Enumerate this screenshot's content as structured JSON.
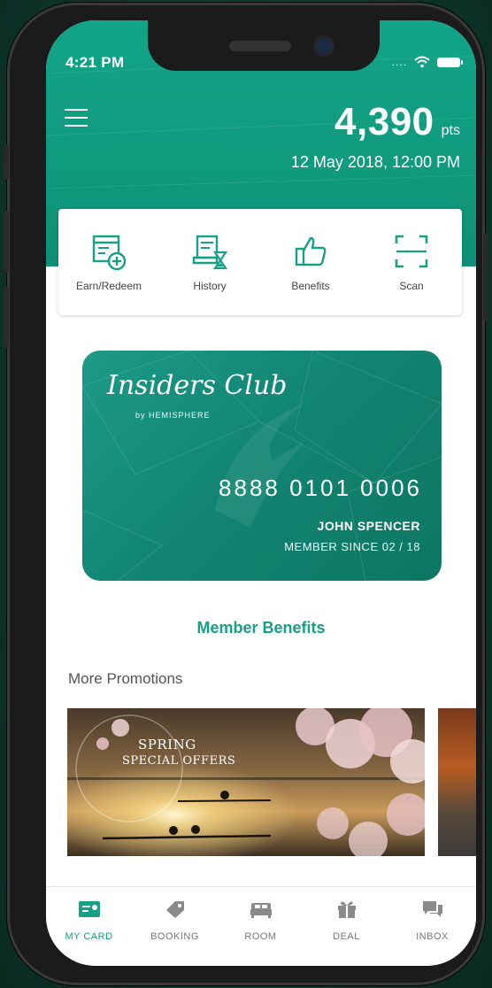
{
  "status_bar": {
    "time": "4:21 PM",
    "signal": "...."
  },
  "header": {
    "points_value": "4,390",
    "points_unit": "pts",
    "datetime": "12 May 2018, 12:00 PM"
  },
  "actions": [
    {
      "label": "Earn/Redeem",
      "icon": "calendar-add-icon"
    },
    {
      "label": "History",
      "icon": "history-icon"
    },
    {
      "label": "Benefits",
      "icon": "thumbs-up-icon"
    },
    {
      "label": "Scan",
      "icon": "scan-icon"
    }
  ],
  "card": {
    "logo": "Insiders Club",
    "logo_by": "by HEMISPHERE",
    "number": "8888 0101 0006",
    "holder": "JOHN SPENCER",
    "member_since": "MEMBER SINCE 02 / 18"
  },
  "member_benefits_link": "Member Benefits",
  "more_promotions_title": "More Promotions",
  "promotions": [
    {
      "title_line1": "SPRING",
      "title_line2": "SPECIAL OFFERS"
    }
  ],
  "tabs": [
    {
      "label": "MY CARD",
      "icon": "card-icon",
      "active": true
    },
    {
      "label": "BOOKING",
      "icon": "tag-icon",
      "active": false
    },
    {
      "label": "ROOM",
      "icon": "bed-icon",
      "active": false
    },
    {
      "label": "DEAL",
      "icon": "gift-icon",
      "active": false
    },
    {
      "label": "INBOX",
      "icon": "chat-icon",
      "active": false
    }
  ],
  "colors": {
    "accent": "#16a085",
    "header": "#12a487",
    "card": "#128673",
    "background": "#0e3a2c"
  }
}
